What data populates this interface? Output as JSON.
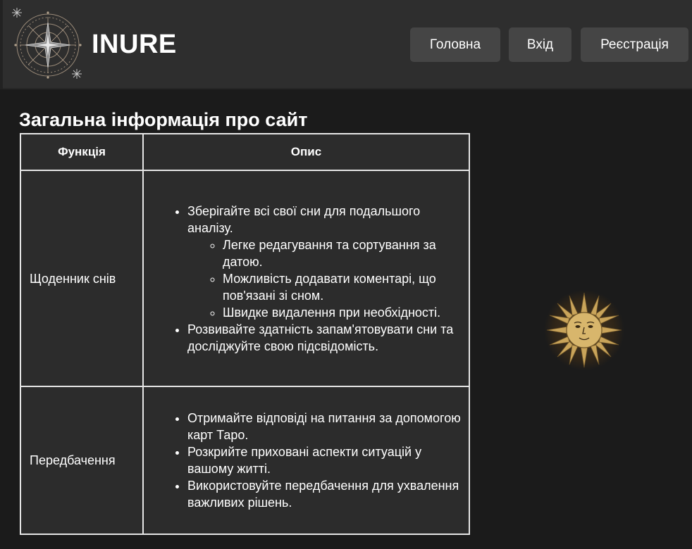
{
  "header": {
    "brand": "INURE",
    "nav": [
      {
        "label": "Головна"
      },
      {
        "label": "Вхід"
      },
      {
        "label": "Реєстрація"
      }
    ]
  },
  "main": {
    "title": "Загальна інформація про сайт",
    "table": {
      "headers": [
        "Функція",
        "Опис"
      ],
      "rows": [
        {
          "function": "Щоденник снів",
          "items": [
            {
              "text": "Зберігайте всі свої сни для подальшого аналізу.",
              "subitems": [
                "Легке редагування та сортування за датою.",
                "Можливість додавати коментарі, що пов'язані зі сном.",
                "Швидке видалення при необхідності."
              ]
            },
            {
              "text": "Розвивайте здатність запам'ятовувати сни та досліджуйте свою підсвідомість."
            }
          ]
        },
        {
          "function": "Передбачення",
          "items": [
            {
              "text": "Отримайте відповіді на питання за допомогою карт Таро."
            },
            {
              "text": "Розкрийте приховані аспекти ситуацій у вашому житті."
            },
            {
              "text": "Використовуйте передбачення для ухвалення важливих рішень."
            }
          ]
        }
      ]
    }
  },
  "icons": {
    "logo": "compass-star-logo-icon",
    "sun": "sun-face-icon"
  },
  "colors": {
    "header_bg": "#2e2e2e",
    "page_bg": "#1b1b1b",
    "button_bg": "#454545",
    "table_bg": "#2c2c2c",
    "sun_gold": "#c9a45a"
  }
}
